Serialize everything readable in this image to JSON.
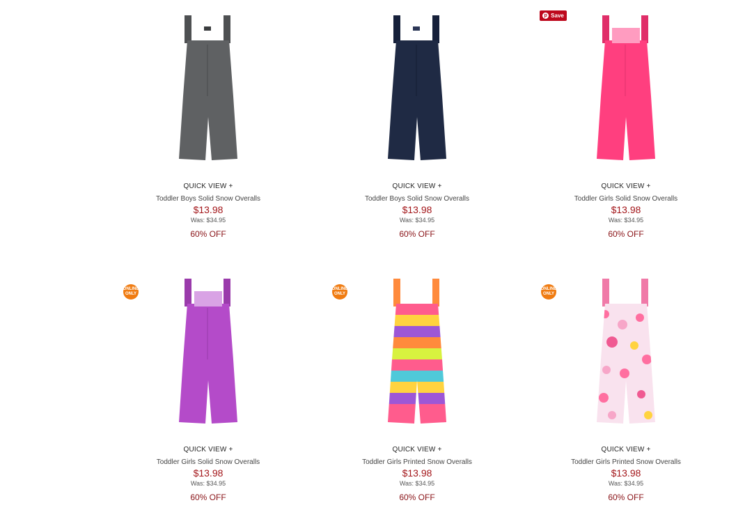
{
  "pinterest": {
    "save_label": "Save",
    "icon_glyph": "p"
  },
  "online_badge": {
    "line1": "ONLINE",
    "line2": "ONLY",
    "color": "#f07c12"
  },
  "colors": {
    "price": "#a3161a",
    "off": "#8a1418"
  },
  "products": [
    {
      "quick_view": "QUICK VIEW +",
      "name": "Toddler Boys Solid Snow Overalls",
      "price": "$13.98",
      "was": "Was: $34.95",
      "discount": "60% OFF",
      "color": "#5f6163",
      "online_only": false
    },
    {
      "quick_view": "QUICK VIEW +",
      "name": "Toddler Boys Solid Snow Overalls",
      "price": "$13.98",
      "was": "Was: $34.95",
      "discount": "60% OFF",
      "color": "#1f2a44",
      "online_only": false
    },
    {
      "quick_view": "QUICK VIEW +",
      "name": "Toddler Girls Solid Snow Overalls",
      "price": "$13.98",
      "was": "Was: $34.95",
      "discount": "60% OFF",
      "color": "#ff3f7f",
      "online_only": false
    },
    {
      "quick_view": "QUICK VIEW +",
      "name": "Toddler Girls Solid Snow Overalls",
      "price": "$13.98",
      "was": "Was: $34.95",
      "discount": "60% OFF",
      "color": "#b44bc9",
      "online_only": true
    },
    {
      "quick_view": "QUICK VIEW +",
      "name": "Toddler Girls Printed Snow Overalls",
      "price": "$13.98",
      "was": "Was: $34.95",
      "discount": "60% OFF",
      "color": "#ff6fa0",
      "online_only": true
    },
    {
      "quick_view": "QUICK VIEW +",
      "name": "Toddler Girls Printed Snow Overalls",
      "price": "$13.98",
      "was": "Was: $34.95",
      "discount": "60% OFF",
      "color": "#f7c6dc",
      "online_only": true
    }
  ]
}
